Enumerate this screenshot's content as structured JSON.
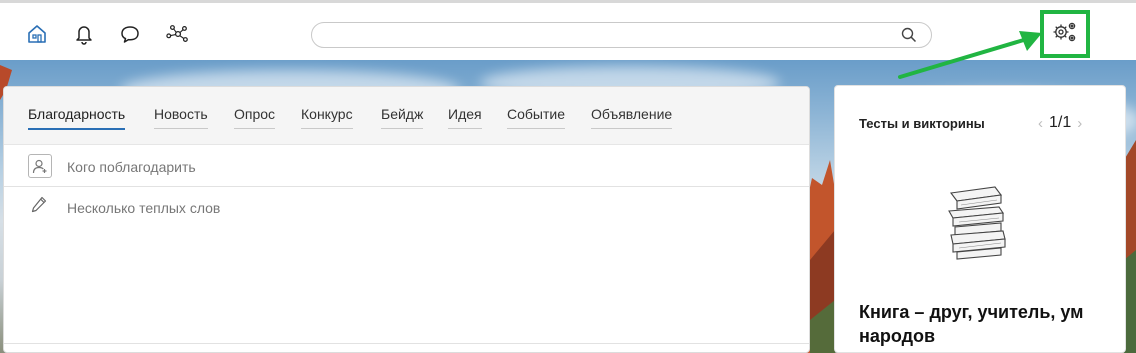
{
  "header": {
    "icons": [
      "home-icon",
      "bell-icon",
      "chat-icon",
      "network-icon"
    ],
    "search": {
      "placeholder": "",
      "value": ""
    },
    "settings_icon": "gear-settings-icon",
    "highlight_color": "#21b542"
  },
  "composer": {
    "tabs": [
      {
        "label": "Благодарность",
        "active": true
      },
      {
        "label": "Новость",
        "active": false
      },
      {
        "label": "Опрос",
        "active": false
      },
      {
        "label": "Конкурс",
        "active": false
      },
      {
        "label": "Бейдж",
        "active": false
      },
      {
        "label": "Идея",
        "active": false
      },
      {
        "label": "Событие",
        "active": false
      },
      {
        "label": "Объявление",
        "active": false
      }
    ],
    "recipient_placeholder": "Кого поблагодарить",
    "message_placeholder": "Несколько теплых слов",
    "accent_color": "#2a6fb5"
  },
  "quiz": {
    "title": "Тесты и викторины",
    "pager": "1/1",
    "item_title_line1": "Книга – друг, учитель, ум",
    "item_title_line2": "народов"
  }
}
